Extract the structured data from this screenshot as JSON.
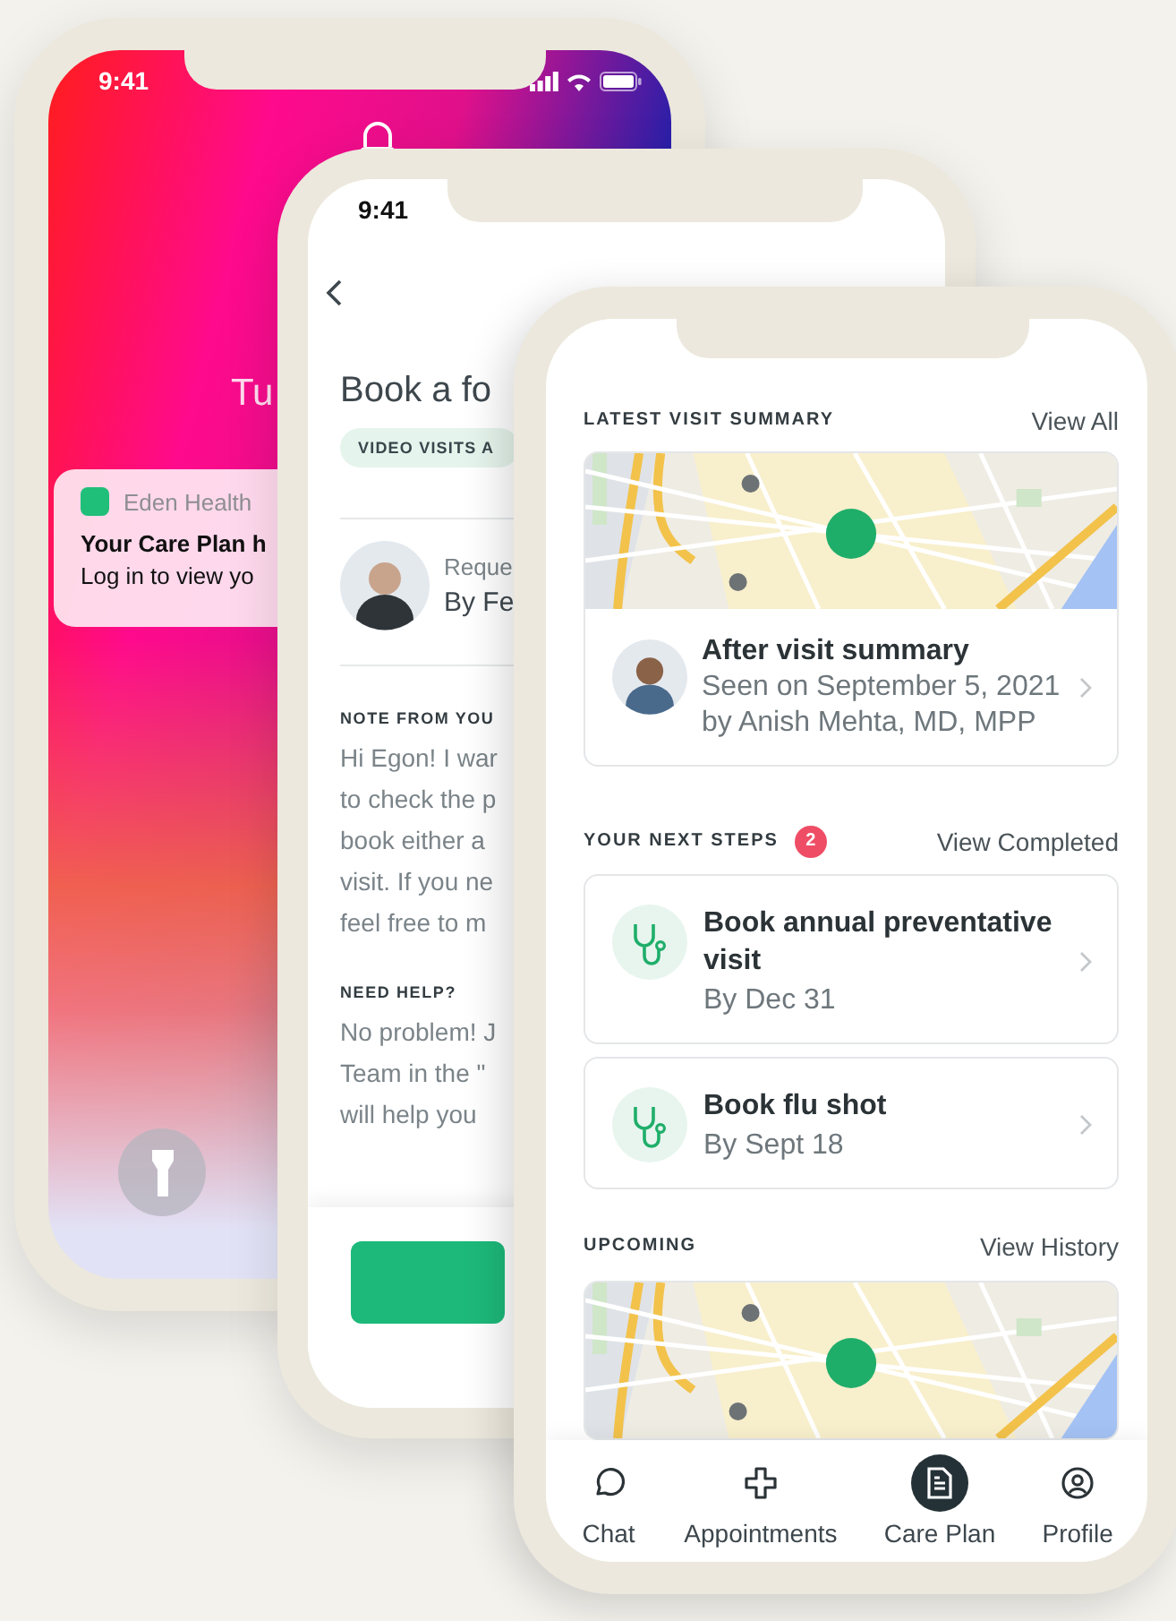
{
  "lock_screen": {
    "time": "9:41",
    "date": "Tu",
    "notification": {
      "app": "Eden Health",
      "title": "Your Care Plan h",
      "body": "Log in to view yo"
    }
  },
  "booking_screen": {
    "time": "9:41",
    "title": "Book a fo",
    "tag": "VIDEO VISITS A",
    "doctor": {
      "line1": "Reque",
      "line2": "By Fe"
    },
    "note_heading": "NOTE FROM YOU",
    "note_lines": [
      "Hi Egon! I war",
      "to check the p",
      "book either a",
      "visit. If you ne",
      "feel free to m"
    ],
    "help_heading": "NEED HELP?",
    "help_lines": [
      "No problem! J",
      "Team in the \"",
      "will help you"
    ]
  },
  "care_plan_screen": {
    "latest": {
      "heading": "LATEST VISIT SUMMARY",
      "link": "View All",
      "visit": {
        "title": "After visit summary",
        "date": "Seen on September 5, 2021",
        "by": "by Anish Mehta, MD, MPP"
      }
    },
    "next_steps": {
      "heading": "YOUR NEXT STEPS",
      "count": "2",
      "link": "View Completed",
      "items": [
        {
          "title": "Book annual preventative visit",
          "due": "By Dec 31"
        },
        {
          "title": "Book flu shot",
          "due": "By Sept 18"
        }
      ]
    },
    "upcoming": {
      "heading": "UPCOMING",
      "link": "View History"
    },
    "nav": [
      {
        "kind": "chat",
        "label": "Chat",
        "selected": false
      },
      {
        "kind": "cross",
        "label": "Appointments",
        "selected": false
      },
      {
        "kind": "document",
        "label": "Care Plan",
        "selected": true
      },
      {
        "kind": "person",
        "label": "Profile",
        "selected": false
      }
    ]
  }
}
